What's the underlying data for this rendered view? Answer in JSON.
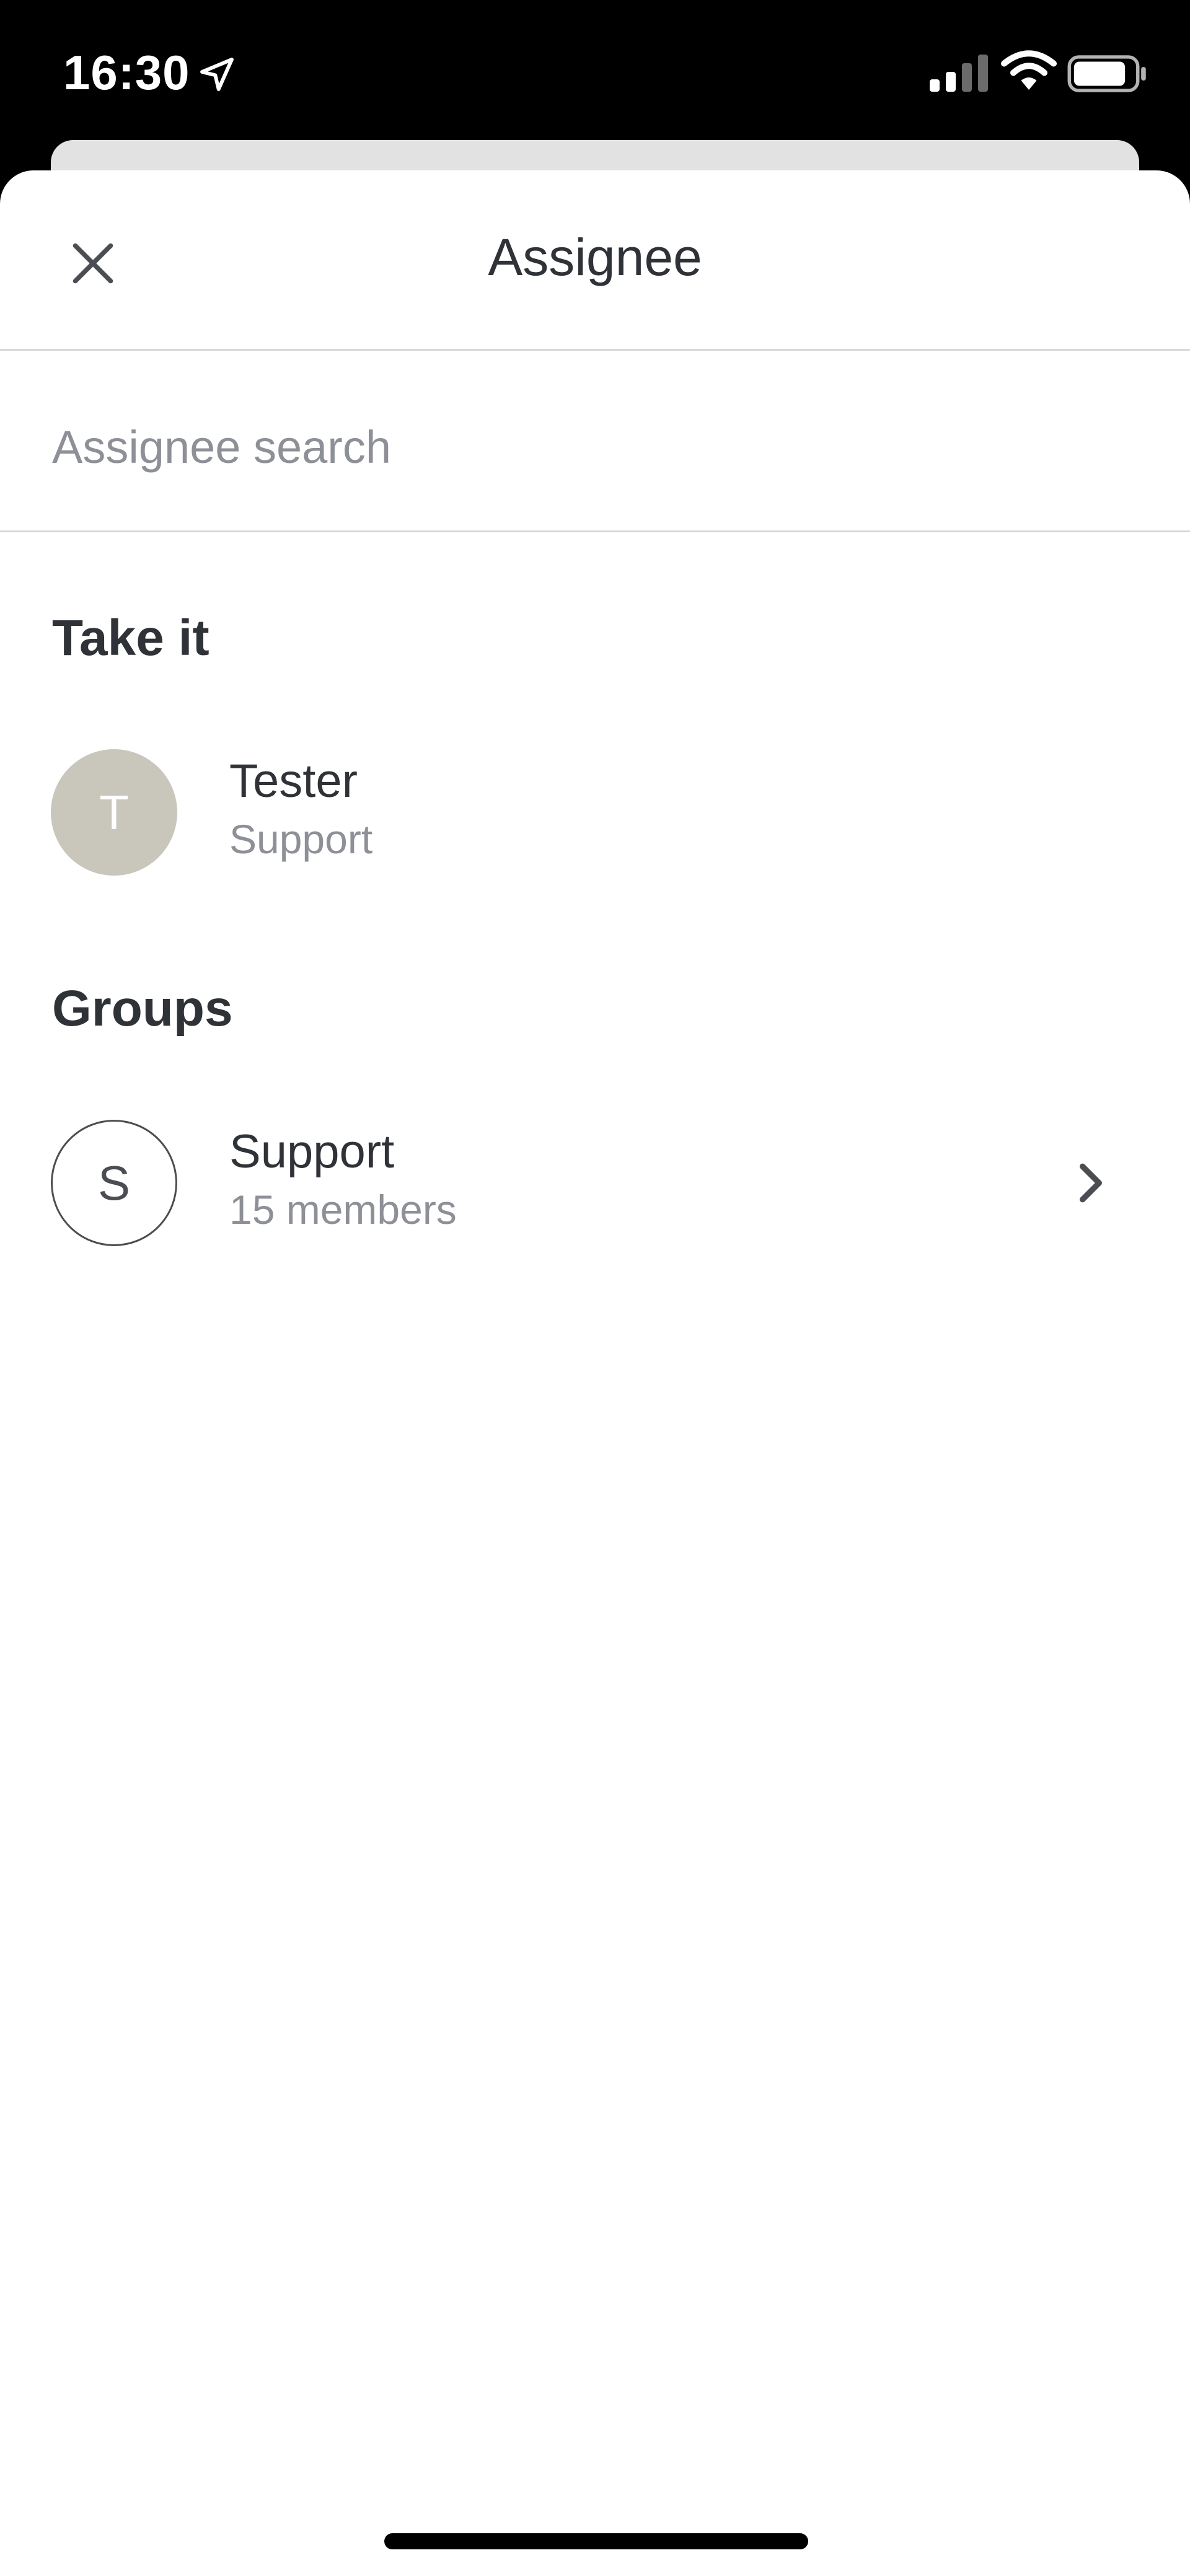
{
  "status_bar": {
    "time": "16:30",
    "icons": [
      "location-arrow-icon",
      "cellular-signal-icon",
      "wifi-icon",
      "battery-icon"
    ]
  },
  "header": {
    "title": "Assignee",
    "close_icon": "close-icon"
  },
  "search": {
    "placeholder": "Assignee search",
    "value": ""
  },
  "take_it": {
    "heading": "Take it",
    "items": [
      {
        "initial": "T",
        "name": "Tester",
        "subtitle": "Support"
      }
    ]
  },
  "groups": {
    "heading": "Groups",
    "items": [
      {
        "initial": "S",
        "name": "Support",
        "subtitle": "15 members",
        "icon": "chevron-right-icon"
      }
    ]
  },
  "colors": {
    "text_primary": "#2f3237",
    "text_secondary": "#8d9096",
    "avatar_fill": "#c9c6bb",
    "divider": "#d8d8d8"
  }
}
